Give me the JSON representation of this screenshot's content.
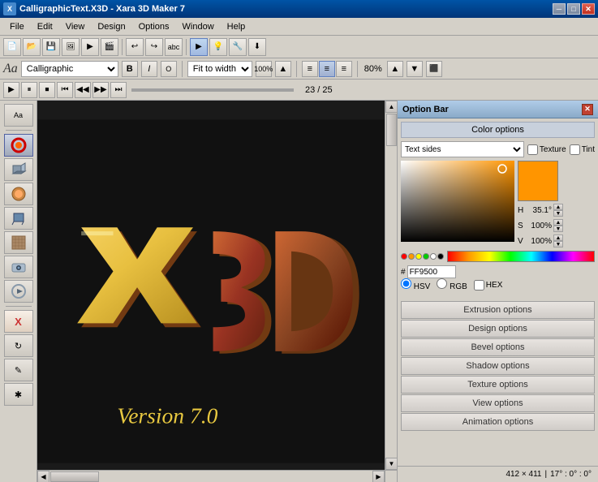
{
  "titleBar": {
    "title": "CalligraphicText.X3D - Xara 3D Maker 7",
    "icon": "X3D",
    "buttons": [
      "minimize",
      "maximize",
      "close"
    ]
  },
  "menuBar": {
    "items": [
      "File",
      "Edit",
      "View",
      "Design",
      "Options",
      "Window",
      "Help"
    ]
  },
  "formatBar": {
    "font": "Calligraphic",
    "fitTo": "Fit to width",
    "zoom": "100%",
    "align": [
      "left",
      "center",
      "right"
    ],
    "percent80": "80%",
    "fitLabel": "Fit to"
  },
  "animBar": {
    "frameCount": "23 / 25"
  },
  "colorPanel": {
    "title": "Option Bar",
    "colorOptionsLabel": "Color options",
    "dropdown": "Text sides",
    "textureLabel": "Texture",
    "tintLabel": "Tint",
    "hValue": "H 35.1°",
    "sValue": "S 100%",
    "vValue": "V 100%",
    "hexLabel": "#",
    "hexValue": "FF9500",
    "hsvLabel": "HSV",
    "rgbLabel": "RGB",
    "hexRadioLabel": "HEX"
  },
  "optionButtons": [
    "Extrusion options",
    "Design options",
    "Bevel options",
    "Shadow options",
    "Texture options",
    "View options",
    "Animation options"
  ],
  "statusBar": {
    "dimensions": "412 × 411",
    "rotation": "17° : 0° : 0°"
  }
}
